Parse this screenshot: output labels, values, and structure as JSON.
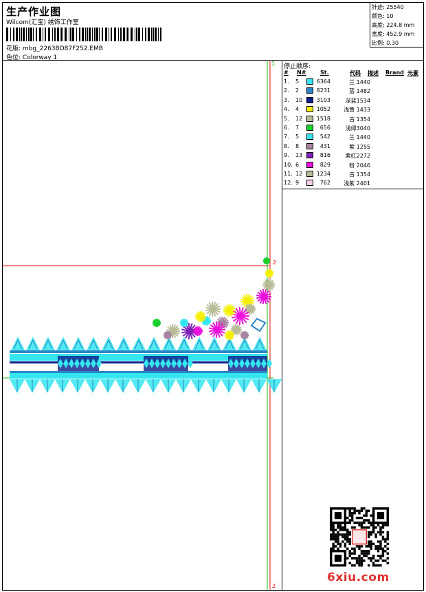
{
  "header": {
    "title": "生产作业图",
    "company": "Wilcom(汇宝) 绣饰工作室",
    "design_label": "花版:",
    "design_value": "mbg_2263BD87F252.EMB",
    "color_label": "色位:",
    "color_value": "Colorway 1"
  },
  "stats": [
    {
      "label": "针迹:",
      "value": "25540"
    },
    {
      "label": "颜色:",
      "value": "10"
    },
    {
      "label": "高度:",
      "value": "224.8 mm"
    },
    {
      "label": "宽度:",
      "value": "452.9 mm"
    },
    {
      "label": "比例:",
      "value": "0.30"
    }
  ],
  "stop_sequence": {
    "title": "停止顺序:",
    "columns": [
      "#",
      "N#",
      "St.",
      "代码",
      "描述",
      "Brand",
      "元素"
    ],
    "rows": [
      {
        "index": "1.",
        "n": "5",
        "color": "#33e6f0",
        "stitches": "6364",
        "code": "兰 1440"
      },
      {
        "index": "2.",
        "n": "2",
        "color": "#2a86c6",
        "stitches": "8231",
        "code": "蓝 1482"
      },
      {
        "index": "3.",
        "n": "10",
        "color": "#0c1e8c",
        "stitches": "3103",
        "code": "深蓝1534"
      },
      {
        "index": "4.",
        "n": "4",
        "color": "#f4f000",
        "stitches": "1052",
        "code": "浅黄 1433"
      },
      {
        "index": "5.",
        "n": "12",
        "color": "#b7bb96",
        "stitches": "1518",
        "code": "古 1354"
      },
      {
        "index": "6.",
        "n": "7",
        "color": "#18d22c",
        "stitches": "656",
        "code": "浅绿3040"
      },
      {
        "index": "7.",
        "n": "5",
        "color": "#33e6f0",
        "stitches": "542",
        "code": "兰 1440"
      },
      {
        "index": "8.",
        "n": "8",
        "color": "#a784a0",
        "stitches": "431",
        "code": "紫 1255"
      },
      {
        "index": "9.",
        "n": "13",
        "color": "#7d1fb8",
        "stitches": "816",
        "code": "紫红2272"
      },
      {
        "index": "10.",
        "n": "6",
        "color": "#ec10dc",
        "stitches": "829",
        "code": "粉 2046"
      },
      {
        "index": "11.",
        "n": "12",
        "color": "#b7bb96",
        "stitches": "1234",
        "code": "古 1354"
      },
      {
        "index": "12.",
        "n": "9",
        "color": "#f6cde4",
        "stitches": "762",
        "code": "浅紫 2401"
      }
    ]
  },
  "markers": {
    "top_one": "1",
    "mid_two": "2",
    "bottom_two": "2"
  },
  "watermark": {
    "site": "6xiu.com"
  }
}
